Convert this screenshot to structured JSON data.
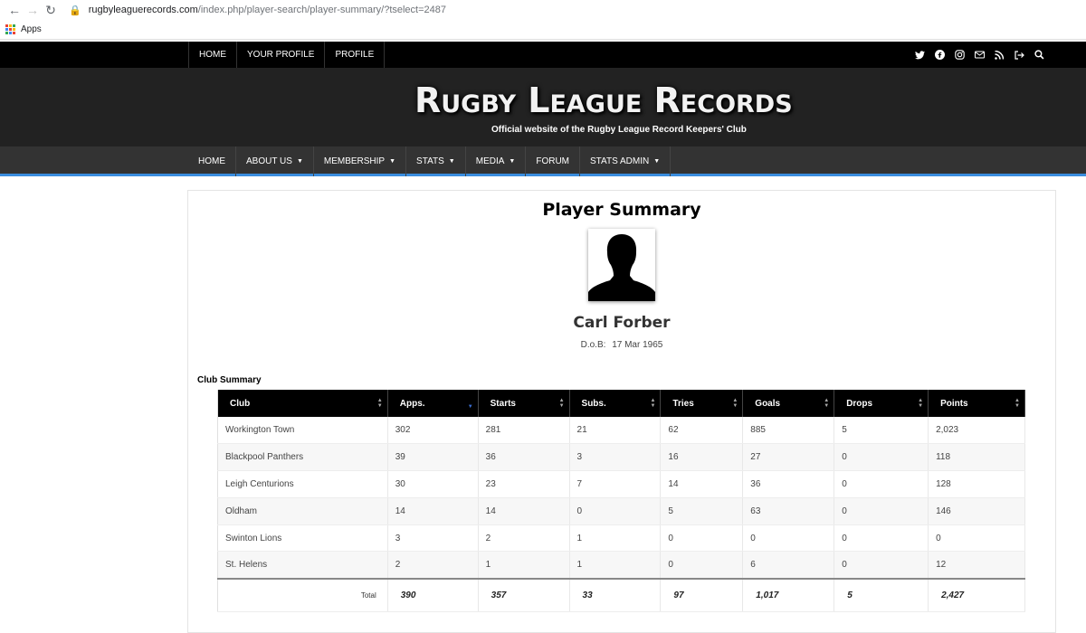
{
  "browser": {
    "url_host": "rugbyleaguerecords.com",
    "url_path": "/index.php/player-search/player-summary/?tselect=2487",
    "bookmark_apps": "Apps"
  },
  "topnav": [
    "HOME",
    "YOUR PROFILE",
    "PROFILE"
  ],
  "social_icons": [
    "twitter-icon",
    "facebook-icon",
    "instagram-icon",
    "email-icon",
    "rss-icon",
    "logout-icon",
    "search-icon"
  ],
  "site": {
    "title": "Rugby League Records",
    "subtitle": "Official website of the Rugby League Record Keepers' Club"
  },
  "mainnav": [
    {
      "label": "HOME",
      "dropdown": false
    },
    {
      "label": "ABOUT US",
      "dropdown": true
    },
    {
      "label": "MEMBERSHIP",
      "dropdown": true
    },
    {
      "label": "STATS",
      "dropdown": true
    },
    {
      "label": "MEDIA",
      "dropdown": true
    },
    {
      "label": "FORUM",
      "dropdown": false
    },
    {
      "label": "STATS ADMIN",
      "dropdown": true
    }
  ],
  "page": {
    "title": "Player Summary",
    "player_name": "Carl Forber",
    "dob_label": "D.o.B:",
    "dob_value": "17 Mar 1965",
    "section_title": "Club Summary"
  },
  "table": {
    "headers": [
      "Club",
      "Apps.",
      "Starts",
      "Subs.",
      "Tries",
      "Goals",
      "Drops",
      "Points"
    ],
    "rows": [
      [
        "Workington Town",
        "302",
        "281",
        "21",
        "62",
        "885",
        "5",
        "2,023"
      ],
      [
        "Blackpool Panthers",
        "39",
        "36",
        "3",
        "16",
        "27",
        "0",
        "118"
      ],
      [
        "Leigh Centurions",
        "30",
        "23",
        "7",
        "14",
        "36",
        "0",
        "128"
      ],
      [
        "Oldham",
        "14",
        "14",
        "0",
        "5",
        "63",
        "0",
        "146"
      ],
      [
        "Swinton Lions",
        "3",
        "2",
        "1",
        "0",
        "0",
        "0",
        "0"
      ],
      [
        "St. Helens",
        "2",
        "1",
        "1",
        "0",
        "6",
        "0",
        "12"
      ]
    ],
    "total_label": "Total",
    "totals": [
      "390",
      "357",
      "33",
      "97",
      "1,017",
      "5",
      "2,427"
    ]
  },
  "colors": {
    "topbar": "#000000",
    "banner": "#222222",
    "mainnav": "#333333",
    "accent": "#3a8dde"
  }
}
